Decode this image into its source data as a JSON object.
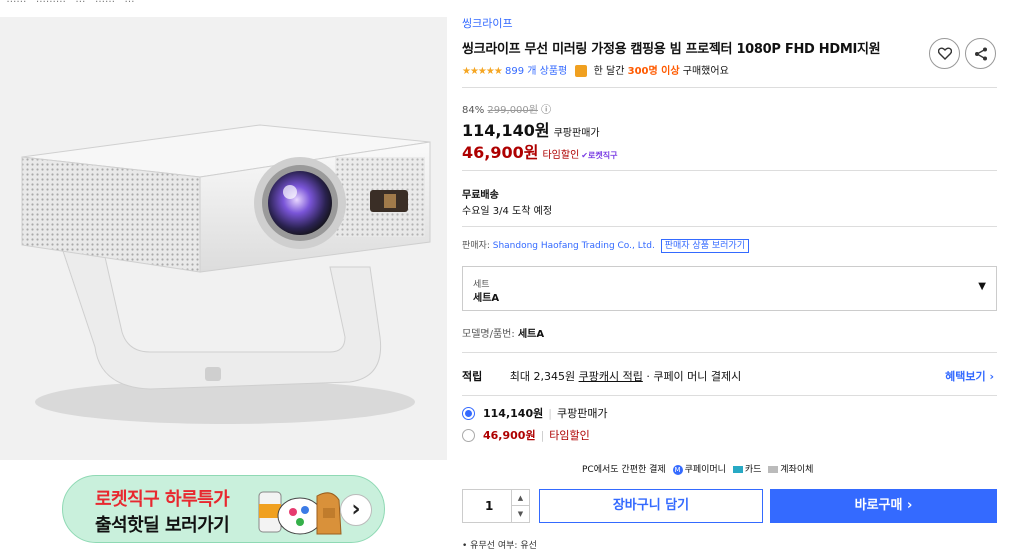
{
  "breadcrumb": "· …… · ……… · … · …… · …",
  "brand": "씽크라이프",
  "title": "씽크라이프 무선 미러링 가정용 캠핑용 빔 프로젝터 1080P FHD HDMI지원",
  "rating": {
    "stars": "★★★★★",
    "reviews": "899 개 상품평",
    "bought_prefix": "한 달간",
    "bought_count": "300명 이상",
    "bought_suffix": "구매했어요"
  },
  "pricing": {
    "discount_rate": "84%",
    "original_price": "299,000원",
    "info_icon": "ⓘ",
    "coupang_price": "114,140원",
    "coupang_label": "쿠팡판매가",
    "sale_price": "46,900원",
    "sale_label": "타임할인",
    "rocket_label": "로켓직구"
  },
  "shipping": {
    "title": "무료배송",
    "date": "수요일 3/4 도착 예정"
  },
  "seller": {
    "prefix": "판매자:",
    "name": "Shandong Haofang Trading Co., Ltd.",
    "link": "판매자 상품 보러가기"
  },
  "option": {
    "label": "세트",
    "value": "세트A",
    "caret": "▼"
  },
  "model": {
    "label": "모델명/품번:",
    "value": "세트A"
  },
  "reward": {
    "title": "적립",
    "text_a": "최대 2,345원",
    "text_link": "쿠팡캐시 적립",
    "text_b": "· 쿠페이 머니 결제시",
    "more": "혜택보기 ›"
  },
  "price_options": [
    {
      "price": "114,140원",
      "label": "쿠팡판매가",
      "selected": true
    },
    {
      "price": "46,900원",
      "label": "타임할인",
      "selected": false
    }
  ],
  "payment": {
    "text": "PC에서도 간편한 결제",
    "coupay_mark": "M",
    "coupay": "쿠페이머니",
    "card": "카드",
    "account": "계좌이체"
  },
  "purchase": {
    "quantity": "1",
    "up": "▲",
    "down": "▼",
    "cart_label": "장바구니 담기",
    "buy_label": "바로구매 ›"
  },
  "spec": "• 유무선 여부: 유선",
  "promo": {
    "line1": "로켓직구 하루특가",
    "line2": "출석핫딜 보러가기",
    "arrow": "›"
  },
  "colors": {
    "accent": "#346aff",
    "sale_red": "#ae0000",
    "star": "#f5a623",
    "promo_bg": "#c9f0dc"
  }
}
